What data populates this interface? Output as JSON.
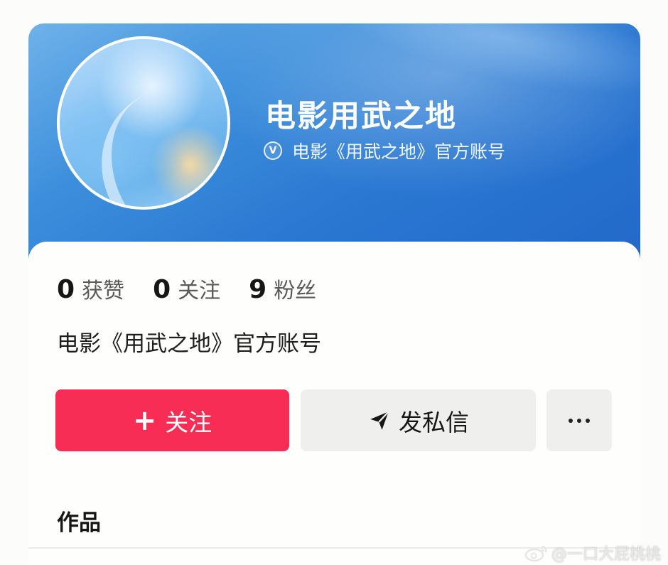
{
  "profile": {
    "name": "电影用武之地",
    "verified_label": "电影《用武之地》官方账号",
    "verified_icon_letter": "V",
    "bio": "电影《用武之地》官方账号"
  },
  "stats": [
    {
      "value": "0",
      "label": "获赞"
    },
    {
      "value": "0",
      "label": "关注"
    },
    {
      "value": "9",
      "label": "粉丝"
    }
  ],
  "actions": {
    "follow_icon": "+",
    "follow_label": "关注",
    "message_label": "发私信",
    "more_icon": "more-dots-icon"
  },
  "tabs": {
    "works_label": "作品"
  },
  "watermark": {
    "text": "@一口大屁桃桃"
  },
  "colors": {
    "banner": "#2a78d2",
    "follow_button": "#f72d55",
    "secondary_button": "#efefed"
  }
}
